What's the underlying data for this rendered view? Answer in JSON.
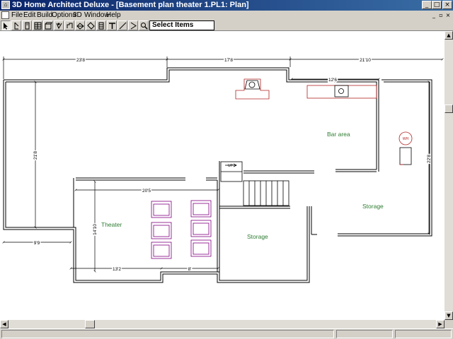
{
  "window": {
    "title": "3D Home Architect Deluxe - [Basement plan theater 1.PL1: Plan]",
    "icon": "app-icon",
    "controls": [
      "minimize-icon",
      "maximize-icon",
      "close-icon"
    ]
  },
  "menu": {
    "items": [
      "File",
      "Edit",
      "Build",
      "Options",
      "3D",
      "Window",
      "Help"
    ],
    "doc_controls": [
      "minimize-icon",
      "restore-icon",
      "close-icon"
    ]
  },
  "toolbar": {
    "tools": [
      "select-arrow-icon",
      "draw-tool-icon",
      "door-tool-icon",
      "wall-tool-icon",
      "cabinet-tool-icon",
      "fixture-tool-icon",
      "furniture-tool-icon",
      "roof-tool-icon",
      "pointer-tool-icon",
      "stairs-tool-icon",
      "text-tool-icon",
      "line-tool-icon",
      "arrow-tool-icon",
      "zoom-icon"
    ],
    "mode_label": "Select Items"
  },
  "plan": {
    "dimensions": {
      "top_left": "23'8",
      "top_mid": "17'8",
      "top_right": "21'10",
      "kitchen_counter": "12'6",
      "left_vertical": "21'8",
      "right_vertical": "22'8",
      "left_bottom": "9'9",
      "theater_width": "20'5",
      "theater_depth": "14'10",
      "theater_bottom_left": "13'2",
      "theater_bottom_right": "8'"
    },
    "rooms": {
      "bar": "Bar area",
      "storage_right": "Storage",
      "storage_center": "Storage",
      "theater": "Theater"
    },
    "fixtures": {
      "water_heater": "WH",
      "stairs": "UP"
    },
    "colors": {
      "wall": "#000000",
      "dimension": "#000000",
      "room_label": "#2e7d32",
      "fixture": "#b22222",
      "seating": "#800080"
    }
  }
}
